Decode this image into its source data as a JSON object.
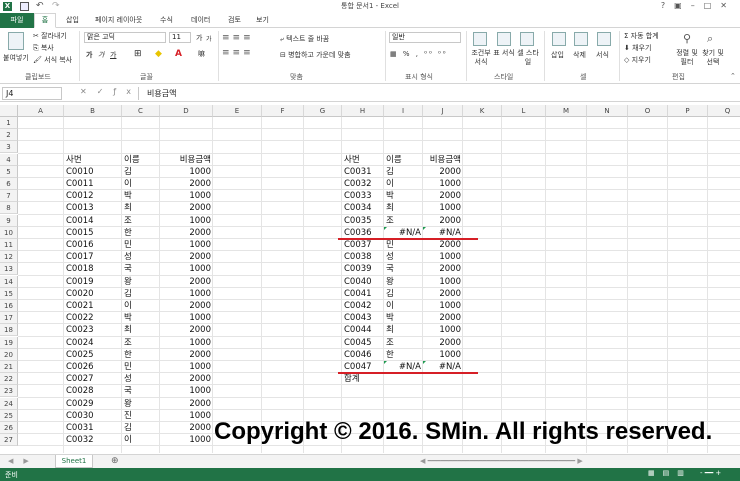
{
  "title": "통합 문서1 - Excel",
  "tabs": {
    "file": "파일",
    "home": "홈",
    "items": [
      "삽입",
      "페이지 레이아웃",
      "수식",
      "데이터",
      "검토",
      "보기"
    ]
  },
  "ribbon": {
    "paste": "붙여넣기",
    "cut": "잘라내기",
    "copy": "복사",
    "format_painter": "서식 복사",
    "font_name": "맑은 고딕",
    "font_size": "11",
    "grow": "가",
    "shrink": "가",
    "bold": "가",
    "italic": "가",
    "underline": "가",
    "wrap_text": "텍스트 줄 바꿈",
    "merge_center": "병합하고 가운데 맞춤",
    "number_format": "일반",
    "cond_format": "조건부 서식",
    "format_table": "표 서식",
    "cell_styles": "셀 스타일",
    "insert": "삽입",
    "delete": "삭제",
    "format": "서식",
    "autosum": "자동 합계",
    "fill": "채우기",
    "clear": "지우기",
    "sort_filter": "정렬 및 필터",
    "find_select": "찾기 및 선택",
    "groups": [
      "클립보드",
      "글꼴",
      "맞춤",
      "표시 형식",
      "스타일",
      "셀",
      "편집"
    ]
  },
  "namebox": "J4",
  "formula": "비용금액",
  "columns": [
    "A",
    "B",
    "C",
    "D",
    "E",
    "F",
    "G",
    "H",
    "I",
    "J",
    "K",
    "L",
    "M",
    "N",
    "O",
    "P",
    "Q"
  ],
  "rows": [
    "1",
    "2",
    "3",
    "4",
    "5",
    "6",
    "7",
    "8",
    "9",
    "10",
    "11",
    "12",
    "13",
    "14",
    "15",
    "16",
    "17",
    "18",
    "19",
    "20",
    "21",
    "22",
    "23",
    "24",
    "25",
    "26",
    "27"
  ],
  "left_table": {
    "header": [
      "사번",
      "이름",
      "비용금액"
    ],
    "data": [
      [
        "C0010",
        "김",
        "1000"
      ],
      [
        "C0011",
        "이",
        "2000"
      ],
      [
        "C0012",
        "박",
        "1000"
      ],
      [
        "C0013",
        "최",
        "2000"
      ],
      [
        "C0014",
        "조",
        "1000"
      ],
      [
        "C0015",
        "한",
        "2000"
      ],
      [
        "C0016",
        "민",
        "1000"
      ],
      [
        "C0017",
        "성",
        "2000"
      ],
      [
        "C0018",
        "국",
        "1000"
      ],
      [
        "C0019",
        "왕",
        "2000"
      ],
      [
        "C0020",
        "김",
        "1000"
      ],
      [
        "C0021",
        "이",
        "2000"
      ],
      [
        "C0022",
        "박",
        "1000"
      ],
      [
        "C0023",
        "최",
        "2000"
      ],
      [
        "C0024",
        "조",
        "1000"
      ],
      [
        "C0025",
        "한",
        "2000"
      ],
      [
        "C0026",
        "민",
        "1000"
      ],
      [
        "C0027",
        "성",
        "2000"
      ],
      [
        "C0028",
        "국",
        "1000"
      ],
      [
        "C0029",
        "왕",
        "2000"
      ],
      [
        "C0030",
        "진",
        "1000"
      ],
      [
        "C0031",
        "김",
        "2000"
      ],
      [
        "C0032",
        "이",
        "1000"
      ]
    ]
  },
  "right_table": {
    "header": [
      "사번",
      "이름",
      "비용금액"
    ],
    "data": [
      [
        "C0031",
        "김",
        "2000"
      ],
      [
        "C0032",
        "이",
        "1000"
      ],
      [
        "C0033",
        "박",
        "2000"
      ],
      [
        "C0034",
        "최",
        "1000"
      ],
      [
        "C0035",
        "조",
        "2000"
      ],
      [
        "C0036",
        "#N/A",
        "#N/A"
      ],
      [
        "C0037",
        "민",
        "2000"
      ],
      [
        "C0038",
        "성",
        "1000"
      ],
      [
        "C0039",
        "국",
        "2000"
      ],
      [
        "C0040",
        "왕",
        "1000"
      ],
      [
        "C0041",
        "김",
        "2000"
      ],
      [
        "C0042",
        "이",
        "1000"
      ],
      [
        "C0043",
        "박",
        "2000"
      ],
      [
        "C0044",
        "최",
        "1000"
      ],
      [
        "C0045",
        "조",
        "2000"
      ],
      [
        "C0046",
        "한",
        "1000"
      ],
      [
        "C0047",
        "#N/A",
        "#N/A"
      ]
    ],
    "total": "합계"
  },
  "copyright": "Copyright © 2016. SMin. All rights reserved.",
  "sheet": "Sheet1",
  "status": "준비",
  "colors": {
    "excel_green": "#217346",
    "error_underline": "#d61f26"
  }
}
